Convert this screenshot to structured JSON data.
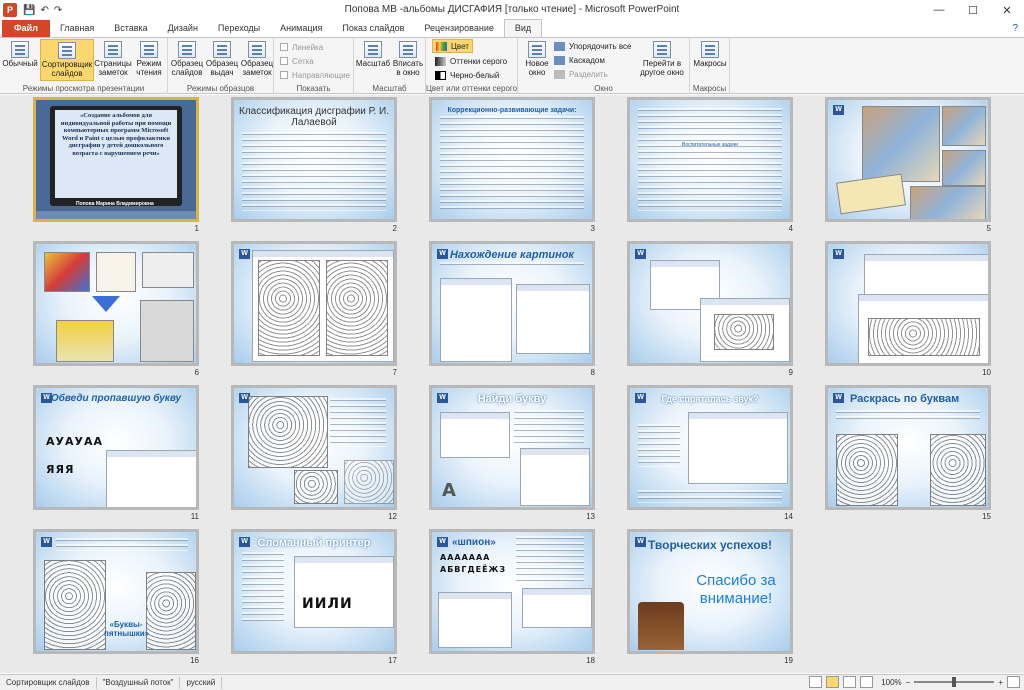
{
  "window": {
    "title": "Попова МВ -альбомы ДИСГАФИЯ [только чтение]  -  Microsoft PowerPoint",
    "app_icon": "P",
    "minimize": "—",
    "maximize": "☐",
    "close": "✕"
  },
  "qat": {
    "save": "💾",
    "undo": "↶",
    "redo": "↷"
  },
  "tabs": [
    "Файл",
    "Главная",
    "Вставка",
    "Дизайн",
    "Переходы",
    "Анимация",
    "Показ слайдов",
    "Рецензирование",
    "Вид"
  ],
  "active_tab": "Вид",
  "ribbon": {
    "groups": {
      "views": "Режимы просмотра презентации",
      "masters": "Режимы образцов",
      "show": "Показать",
      "zoom": "Масштаб",
      "color": "Цвет или оттенки серого",
      "window": "Окно",
      "macros": "Макросы"
    },
    "buttons": {
      "normal": "Обычный",
      "sorter": "Сортировщик слайдов",
      "notes": "Страницы заметок",
      "reading": "Режим чтения",
      "slide_master": "Образец слайдов",
      "handout_master": "Образец выдач",
      "notes_master": "Образец заметок",
      "zoom": "Масштаб",
      "fit": "Вписать в окно",
      "new_window": "Новое окно",
      "switch_windows": "Перейти в другое окно",
      "macros": "Макросы"
    },
    "checkboxes": {
      "ruler": "Линейка",
      "grid": "Сетка",
      "guides": "Направляющие"
    },
    "color_options": {
      "color": "Цвет",
      "grayscale": "Оттенки серого",
      "bw": "Черно-белый"
    },
    "window_options": {
      "arrange": "Упорядочить все",
      "cascade": "Каскадом",
      "split": "Разделить"
    }
  },
  "slides": [
    {
      "number": "1",
      "title": "«Создание альбомов для индивидуальной работы при помощи компьютерных программ Microsoft Word и Paint с целью профилактики дисграфии у детей дошкольного возраста с нарушением речи»",
      "footer": "Попова Марина Владимировна"
    },
    {
      "number": "2",
      "title": "Классификация дисграфии Р. И. Лалаевой"
    },
    {
      "number": "3",
      "title": "Коррекционно-развивающие задачи:"
    },
    {
      "number": "4",
      "title": "Воспитательные задачи"
    },
    {
      "number": "5",
      "title": ""
    },
    {
      "number": "6",
      "title": ""
    },
    {
      "number": "7",
      "title": ""
    },
    {
      "number": "8",
      "title": "Нахождение картинок"
    },
    {
      "number": "9",
      "title": ""
    },
    {
      "number": "10",
      "title": ""
    },
    {
      "number": "11",
      "title": "Обведи пропавшую букву",
      "letters": "АУАУАА  ЯЯЯ"
    },
    {
      "number": "12",
      "title": ""
    },
    {
      "number": "13",
      "title": "Найди букву"
    },
    {
      "number": "14",
      "title": "Где спряталась звук?"
    },
    {
      "number": "15",
      "title": "Раскрась по буквам"
    },
    {
      "number": "16",
      "title": "«Буквы-пятнышки»"
    },
    {
      "number": "17",
      "title": "Сломанный принтер",
      "letters": "ИИЛИ"
    },
    {
      "number": "18",
      "title": "«шпион»",
      "letters": "ААААААА  АБВГДЕЁЖЗ"
    },
    {
      "number": "19",
      "title": "Творческих успехов!",
      "subtitle": "Спасибо за внимание!"
    }
  ],
  "selected_slide": "1",
  "status": {
    "mode": "Сортировщик слайдов",
    "theme": "\"Воздушный поток\"",
    "language": "русский",
    "zoom": "100%",
    "zoom_minus": "−",
    "zoom_plus": "+"
  },
  "colors": {
    "file_tab": "#d24726",
    "active_button": "#fbd76d",
    "slide_selected_border": "#d7b44a",
    "slide_title_blue": "#1f5fa8"
  }
}
